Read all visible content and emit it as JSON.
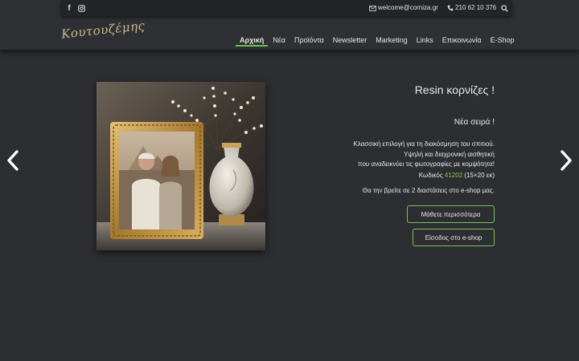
{
  "topbar": {
    "facebook_icon": "facebook-icon",
    "instagram_icon": "instagram-icon",
    "email": "welcome@corniza.gr",
    "phone": "210 62 10 376",
    "search_icon": "search-icon"
  },
  "logo": {
    "text": "Κουτουζέμης"
  },
  "nav": {
    "items": [
      {
        "label": "Αρχική",
        "active": true
      },
      {
        "label": "Νέα"
      },
      {
        "label": "Προϊόντα"
      },
      {
        "label": "Newsletter"
      },
      {
        "label": "Marketing"
      },
      {
        "label": "Links"
      },
      {
        "label": "Επικοινωνία"
      },
      {
        "label": "E-Shop"
      }
    ]
  },
  "slide": {
    "title": "Resin κορνίζες !",
    "subtitle": "Νέα σειρά !",
    "description": [
      "Κλασσική επιλογή για τη διακόσμηση του σπιτιού.",
      "Υψηλή και διαχρονική αισθητική",
      "που αναδεικνύει τις φωτογραφίες με κομψότητα!"
    ],
    "code_prefix": "Κωδικός",
    "code_value": "41202",
    "code_suffix": "(15×20 εκ)",
    "sizes_text": "Θα την βρείτε σε 2 διαστάσεις στο e-shop μας.",
    "button_more": "Μάθετε περισσότερα",
    "button_shop": "Είσοδος στο e-shop"
  },
  "colors": {
    "accent": "#7cc35a",
    "code_highlight": "#8bc34a",
    "background": "#2c2e32"
  },
  "carousel": {
    "prev_icon": "chevron-left-icon",
    "next_icon": "chevron-right-icon"
  }
}
